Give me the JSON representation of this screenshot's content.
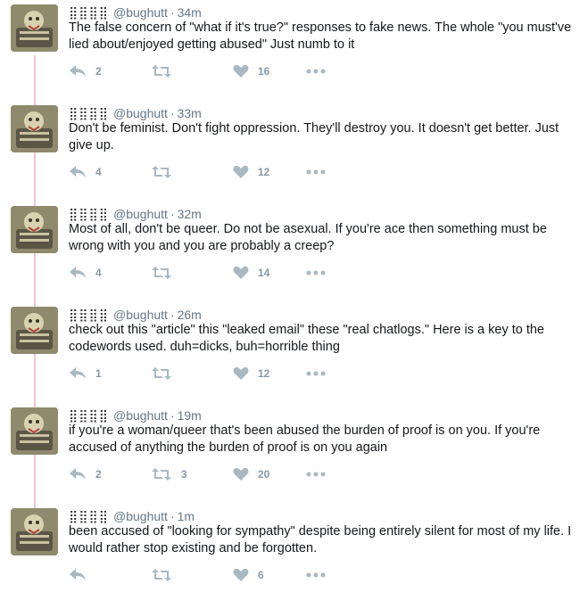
{
  "tweets": [
    {
      "name": "⣿⣿⣿⣿",
      "handle": "@bughutt",
      "sep": "·",
      "time": "34m",
      "text": "The false concern of \"what if it's true?\" responses to fake news. The whole \"you must've lied about/enjoyed getting abused\" Just numb to it",
      "replies": "2",
      "retweets": "",
      "likes": "16"
    },
    {
      "name": "⣿⣿⣿⣿",
      "handle": "@bughutt",
      "sep": "·",
      "time": "33m",
      "text": "Don't be feminist. Don't fight oppression. They'll destroy you. It doesn't get better. Just give up.",
      "replies": "4",
      "retweets": "",
      "likes": "12"
    },
    {
      "name": "⣿⣿⣿⣿",
      "handle": "@bughutt",
      "sep": "·",
      "time": "32m",
      "text": "Most of all, don't be queer. Do not be asexual. If you're ace then something must be wrong with you and you are probably a creep?",
      "replies": "4",
      "retweets": "",
      "likes": "14"
    },
    {
      "name": "⣿⣿⣿⣿",
      "handle": "@bughutt",
      "sep": "·",
      "time": "26m",
      "text": "check out this \"article\" this \"leaked email\" these \"real chatlogs.\" Here is a key to the codewords used. duh=dicks, buh=horrible thing",
      "replies": "1",
      "retweets": "",
      "likes": "12"
    },
    {
      "name": "⣿⣿⣿⣿",
      "handle": "@bughutt",
      "sep": "·",
      "time": "19m",
      "text": "if you're a woman/queer that's been abused the burden of proof is on you. If you're accused of anything the burden of proof is on you again",
      "replies": "2",
      "retweets": "3",
      "likes": "20"
    },
    {
      "name": "⣿⣿⣿⣿",
      "handle": "@bughutt",
      "sep": "·",
      "time": "1m",
      "text": "been accused of \"looking for sympathy\" despite being entirely silent for most of my life. I would rather stop existing and be forgotten.",
      "replies": "",
      "retweets": "",
      "likes": "6"
    }
  ],
  "icons": {
    "reply": "reply-icon",
    "retweet": "retweet-icon",
    "like": "heart-icon",
    "more": "more-icon"
  },
  "colors": {
    "thread_line": "#f2c6d0",
    "icon": "#aab8c2",
    "muted_text": "#657786"
  }
}
